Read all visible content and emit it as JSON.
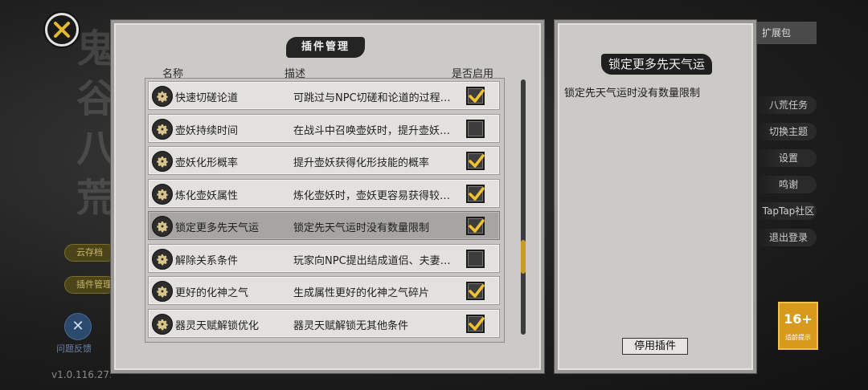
{
  "background": {
    "calligraphy": "鬼谷八荒",
    "chip_1": "云存档",
    "chip_2": "插件管理",
    "help_label": "问题反馈",
    "version": "v1.0.116.273",
    "menu": [
      "扩展包",
      "八荒任务",
      "切换主题",
      "设置",
      "鸣谢",
      "TapTap社区",
      "退出登录"
    ],
    "age_rating": "16+",
    "age_rating_caption": "适龄提示"
  },
  "panel": {
    "title": "插件管理",
    "col_name": "名称",
    "col_desc": "描述",
    "col_enabled": "是否启用"
  },
  "plugins": [
    {
      "name": "快速切磋论道",
      "desc": "可跳过与NPC切磋和论道的过程…",
      "enabled": true,
      "selected": false
    },
    {
      "name": "壶妖持续时间",
      "desc": "在战斗中召唤壶妖时，提升壶妖…",
      "enabled": false,
      "selected": false
    },
    {
      "name": "壶妖化形概率",
      "desc": "提升壶妖获得化形技能的概率",
      "enabled": true,
      "selected": false
    },
    {
      "name": "炼化壶妖属性",
      "desc": "炼化壶妖时，壶妖更容易获得较…",
      "enabled": true,
      "selected": false
    },
    {
      "name": "锁定更多先天气运",
      "desc": "锁定先天气运时没有数量限制",
      "enabled": true,
      "selected": true
    },
    {
      "name": "解除关系条件",
      "desc": "玩家向NPC提出结成道侣、夫妻…",
      "enabled": false,
      "selected": false
    },
    {
      "name": "更好的化神之气",
      "desc": "生成属性更好的化神之气碎片",
      "enabled": true,
      "selected": false
    },
    {
      "name": "器灵天赋解锁优化",
      "desc": "器灵天赋解锁无其他条件",
      "enabled": true,
      "selected": false
    }
  ],
  "scroll": {
    "thumb_start": 0.63,
    "thumb_size": 0.13
  },
  "detail": {
    "title": "锁定更多先天气运",
    "description": "锁定先天气运时没有数量限制",
    "disable_button": "停用插件"
  },
  "colors": {
    "checkmark": "#f2c230",
    "scroll_thumb": "#c79a2a",
    "selected_row": "#a6a5a2"
  }
}
